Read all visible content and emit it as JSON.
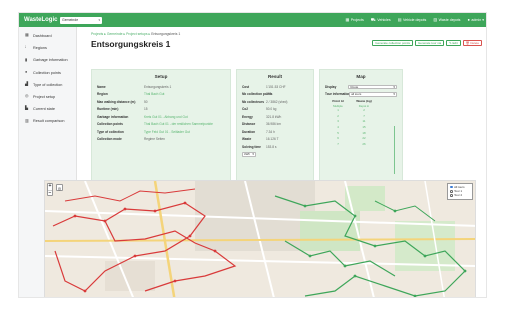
{
  "topbar": {
    "brand": "WasteLogic",
    "group_select": "Gemeinde",
    "nav": [
      {
        "icon": "grid-icon",
        "glyph": "▦",
        "label": "Projects"
      },
      {
        "icon": "truck-icon",
        "glyph": "⛟",
        "label": "Vehicles"
      },
      {
        "icon": "depot-icon",
        "glyph": "▤",
        "label": "Vehicle depots"
      },
      {
        "icon": "dump-icon",
        "glyph": "▥",
        "label": "Waste depots"
      },
      {
        "icon": "user-icon",
        "glyph": "●",
        "label": "admin ▾"
      }
    ]
  },
  "sidebar": {
    "items": [
      {
        "glyph": "▦",
        "label": "Dashboard"
      },
      {
        "glyph": "⁞",
        "label": "Regions"
      },
      {
        "glyph": "▮",
        "label": "Garbage information"
      },
      {
        "glyph": "●",
        "label": "Collection points"
      },
      {
        "glyph": "▟",
        "label": "Type of collection"
      },
      {
        "glyph": "◎",
        "label": "Project setup"
      },
      {
        "glyph": "▙",
        "label": "Current state"
      },
      {
        "glyph": "▥",
        "label": "Result comparison"
      }
    ]
  },
  "breadcrumb": {
    "items": [
      "Projects",
      "Gemeinde",
      "Project setups"
    ],
    "current": "Entsorgungskreis 1"
  },
  "page": {
    "title": "Entsorgungskreis 1",
    "actions": {
      "generate_points": "Generate collection points",
      "generate_tour": "Generate tour via",
      "edit": "✎ Edit",
      "delete": "🗑 Delete"
    }
  },
  "setup": {
    "heading": "Setup",
    "rows": [
      {
        "label": "Name",
        "value": "Entsorgungskreis 1",
        "link": false
      },
      {
        "label": "Region",
        "value": "Thal Bach Gut",
        "link": true
      },
      {
        "label": "Max walking distance (m)",
        "value": "50",
        "link": false
      },
      {
        "label": "Runtime (min)",
        "value": "15",
        "link": false
      },
      {
        "label": "Garbage information",
        "value": "Kreis Gut 01 - Abhang und Gut",
        "link": true
      },
      {
        "label": "Collection points",
        "value": "Thal Bach Gut 01 - der restlichen Sammelpunkte",
        "link": true
      },
      {
        "label": "Type of collection",
        "value": "Type Feld Gut 01 - Seitlader Gut",
        "link": true
      },
      {
        "label": "Collection mode",
        "value": "Regime Seiten",
        "link": false
      }
    ]
  },
  "result": {
    "heading": "Result",
    "rows": [
      {
        "label": "Cost",
        "value": "1'151.53 CHF"
      },
      {
        "label": "Nb collection points",
        "value": "229"
      },
      {
        "label": "Nb collecteurs",
        "value": "2 / 3862 (shed)"
      },
      {
        "label": "Co2",
        "value": "50.0 kg"
      },
      {
        "label": "Energy",
        "value": "321.8 kWh"
      },
      {
        "label": "Distance",
        "value": "36.986 km"
      },
      {
        "label": "Duration",
        "value": "7.34 h"
      },
      {
        "label": "Waste",
        "value": "16.126 T"
      },
      {
        "label": "Solving time",
        "value": "153.8 s"
      }
    ],
    "unit_select": "kWh"
  },
  "map_panel": {
    "heading": "Map",
    "display_label": "Display",
    "display_value": "Route",
    "tour_label": "Tour information",
    "tour_value": "all tours",
    "col_point": "Point Id",
    "col_waste": "Waste (kg)",
    "sub_point": "Multiple",
    "sub_waste": "Depot in",
    "rows": [
      {
        "point": "1",
        "waste": "2"
      },
      {
        "point": "2",
        "waste": "7"
      },
      {
        "point": "3",
        "waste": "11"
      },
      {
        "point": "4",
        "waste": "15"
      },
      {
        "point": "5",
        "waste": "18"
      },
      {
        "point": "6",
        "waste": "22"
      },
      {
        "point": "7",
        "waste": "26"
      }
    ]
  },
  "map": {
    "legend": [
      "All tours",
      "Tour 1",
      "Tour 2"
    ]
  },
  "colors": {
    "brand_green": "#3ea65a",
    "panel_bg": "#e7f3e8",
    "link_green": "#58b56f",
    "route_red": "#d93a3a",
    "route_green": "#3ea65a"
  }
}
